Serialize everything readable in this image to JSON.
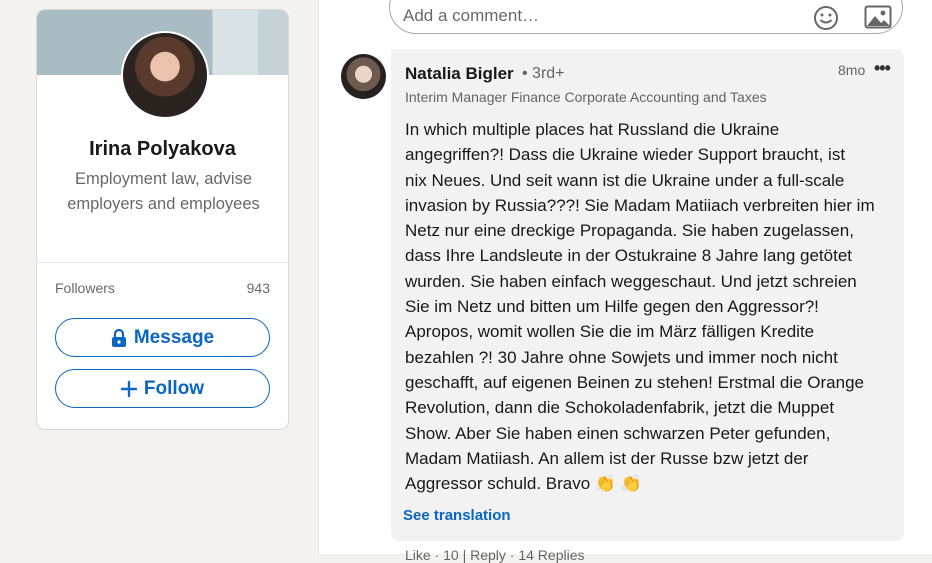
{
  "profile": {
    "name": "Irina Polyakova",
    "headline": "Employment law, advise employers and employees",
    "followers_label": "Followers",
    "followers_count": "943",
    "message_label": "Message",
    "follow_label": "Follow",
    "icons": {
      "message": "lock-icon",
      "follow": "plus-icon"
    }
  },
  "comment_input": {
    "placeholder": "Add a comment…",
    "icons": [
      "emoji-icon",
      "image-icon"
    ]
  },
  "comment": {
    "author": "Natalia Bigler",
    "degree": "• 3rd+",
    "time": "8mo",
    "more": "•••",
    "headline": "Interim Manager Finance Corporate Accounting and Taxes",
    "text": "In which multiple places hat Russland die Ukraine\nangegriffen?! Dass die Ukraine wieder Support braucht, ist\nnix Neues. Und seit wann ist die Ukraine under a full-scale\ninvasion by Russia???! Sie Madam Matiiach verbreiten hier im\nNetz nur eine dreckige Propaganda. Sie haben zugelassen,\ndass Ihre Landsleute in der Ostukraine 8 Jahre lang getötet\nwurden. Sie haben einfach weggeschaut. Und jetzt schreien\nSie im Netz und bitten um Hilfe gegen den Aggressor?!\nApropos, womit wollen Sie die im März fälligen Kredite\nbezahlen ?! 30 Jahre ohne Sowjets und immer noch nicht\ngeschafft, auf eigenen Beinen zu stehen! Erstmal die Orange\nRevolution, dann die Schokoladenfabrik, jetzt die Muppet\nShow. Aber Sie haben einen schwarzen Peter gefunden,\nMadam Matiiash. An allem ist der Russe bzw jetzt der\nAggressor schuld. Bravo 👏 👏",
    "see_translation": "See translation",
    "actions_partial": "Like · 10 | Reply · 14 Replies"
  },
  "colors": {
    "accent": "#0a66c2",
    "page_bg": "#f4f2ee",
    "bubble_bg": "#f2f2f2"
  }
}
